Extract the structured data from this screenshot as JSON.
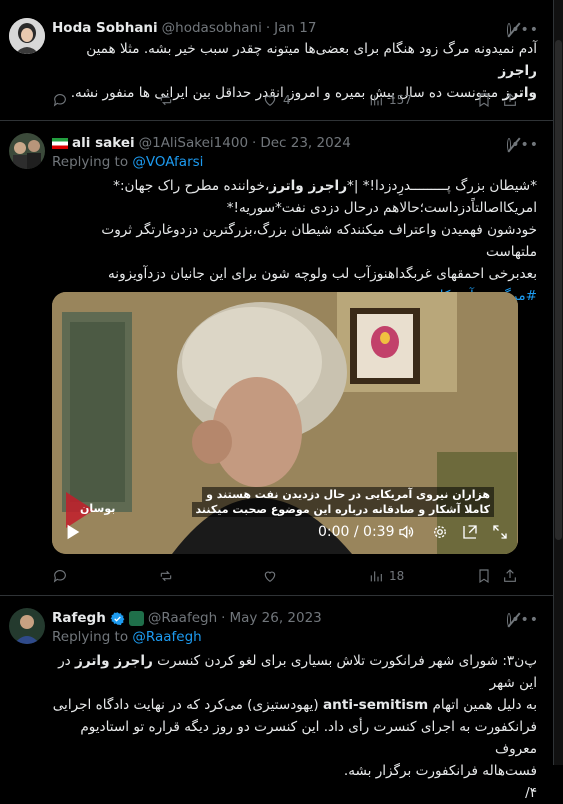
{
  "tweets": [
    {
      "name": "Hoda Sobhani",
      "handle": "@hodasobhani",
      "sep": "·",
      "date": "Jan 17",
      "text_line1": "آدم نمیدونه مرگ زود هنگام برای بعضی‌ها میتونه چقدر سبب خیر بشه. مثلا همین",
      "text_bold1": "راجرز",
      "text_bold2": "واترز",
      "text_line2": "میتونست ده سال پیش بمیره و امروز انقدر حداقل بین ایرانی ها منفور نشه.",
      "likes": "4",
      "views": "157"
    },
    {
      "name": "ali sakei",
      "handle": "@1AliSakei1400",
      "sep": "·",
      "date": "Dec 23, 2024",
      "replying_prefix": "Replying to",
      "replying_to": "@VOAfarsi",
      "line1_a": "*شیطان بزرگ پـــــــــدرِدزدا!* |*",
      "line1_b": "راجرز واترز",
      "line1_c": "،خواننده مطرح راک جهان:*",
      "line2": "امریکااصالتاًدزداست؛حالاهم درحال دزدی نفت*سوریه!*",
      "line3": "خودشون فهمیدن واعتراف میکنندکه شیطان بزرگ،بزرگترین دزدوغارتگر ثروت ملتهاست",
      "line4": "بعدبرخی احمقهای غربگداهنوزآب لب ولوچه شون برای این جانیان دزدآویزونه",
      "hashtag": "#مرگ_بر_آمریکا",
      "video": {
        "caption1": "هزاران نیروی آمریکایی در حال دزدیدن نفت هستند و",
        "caption2": "کاملا آشکار و صادقانه درباره این موضوع صحبت میکنند",
        "watermark": "بوسان",
        "time": "0:00 / 0:39"
      },
      "views": "18"
    },
    {
      "name": "Rafegh",
      "handle": "@Raafegh",
      "sep": "·",
      "date": "May 26, 2023",
      "replying_prefix": "Replying to",
      "replying_to": "@Raafegh",
      "line1_a": "پ‌ن۳: شورای شهر فرانکورت تلاش بسیاری برای لغو کردن کنسرت",
      "line1_b": "راجرز واترز",
      "line1_c": "در این شهر",
      "line2_a": "به دلیل همین اتهام",
      "line2_b": "anti-semitism",
      "line2_c": "(یهودستیزی) می‌کرد که در نهایت دادگاه اجرایی",
      "line3": "فرانکفورت به اجرای کنسرت رأی داد. این کنسرت دو روز دیگه قراره تو استادیوم معروف",
      "line4": "فست‌هاله فرانکفورت برگزار بشه.",
      "line5": "۴/"
    }
  ],
  "colors": {
    "accent": "#1d9bf0",
    "muted": "#71767b",
    "text": "#e7e9ea",
    "bg": "#000000",
    "border": "#2f3336"
  }
}
